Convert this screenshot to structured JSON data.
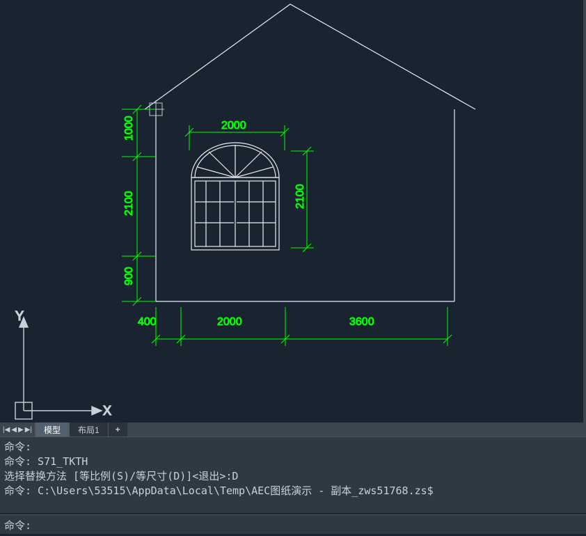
{
  "axis": {
    "x": "X",
    "y": "Y"
  },
  "dimensions": {
    "top_width": "2000",
    "right_height": "2100",
    "left_upper": "1000",
    "left_middle": "2100",
    "left_lower": "900",
    "bottom_a": "400",
    "bottom_b": "2000",
    "bottom_c": "3600"
  },
  "tabs": {
    "model": "模型",
    "layout1": "布局1",
    "add": "+"
  },
  "command_history": {
    "line1": "命令:",
    "line2": "命令: S71_TKTH",
    "line3": "选择替换方法 [等比例(S)/等尺寸(D)]<退出>:D",
    "line4": "命令: C:\\Users\\53515\\AppData\\Local\\Temp\\AEC图纸演示 - 副本_zws51768.zs$"
  },
  "command_prompt": "命令:"
}
